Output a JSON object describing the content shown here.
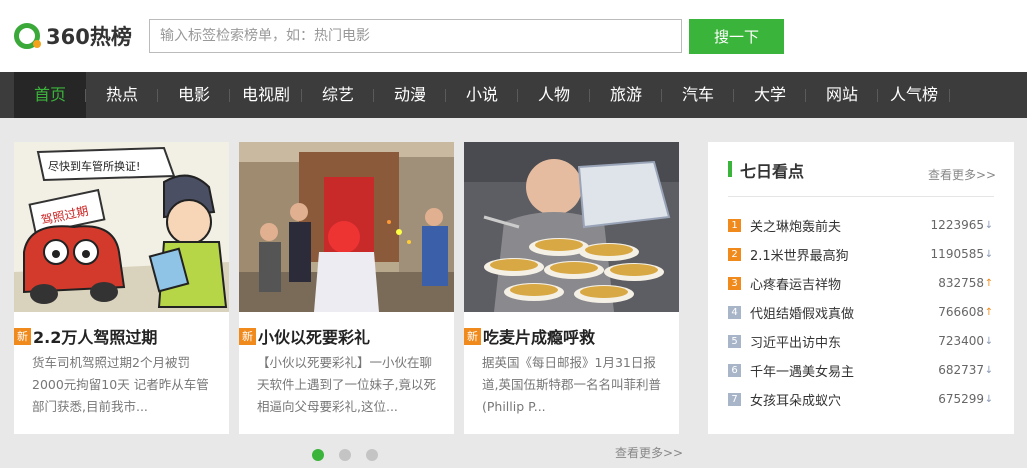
{
  "brand": {
    "logo_text": "360热榜"
  },
  "search": {
    "placeholder": "输入标签检索榜单，如：热门电影",
    "button_label": "搜一下"
  },
  "nav": {
    "items": [
      "首页",
      "热点",
      "电影",
      "电视剧",
      "综艺",
      "动漫",
      "小说",
      "人物",
      "旅游",
      "汽车",
      "大学",
      "网站",
      "人气榜"
    ],
    "active_index": 0
  },
  "cards": [
    {
      "tag": "新",
      "title": "2.2万人驾照过期",
      "desc": "货车司机驾照过期2个月被罚2000元拘留10天 记者昨从车管部门获悉,目前我市...",
      "image_text": [
        "尽快到车管所换证!",
        "驾照过期"
      ]
    },
    {
      "tag": "新",
      "title": "小伙以死要彩礼",
      "desc": "【小伙以死要彩礼】一小伙在聊天软件上遇到了一位妹子,竟以死相逼向父母要彩礼,这位..."
    },
    {
      "tag": "新",
      "title": "吃麦片成瘾呼救",
      "desc": "据英国《每日邮报》1月31日报道,英国伍斯特郡一名名叫菲利普(Phillip P..."
    }
  ],
  "carousel": {
    "more_label": "查看更多>>",
    "pages": 3,
    "active_page": 1
  },
  "seven_day": {
    "title": "七日看点",
    "more_label": "查看更多>>",
    "items": [
      {
        "rank": "1",
        "name": "关之琳炮轰前夫",
        "value": "1223965",
        "trend": "down",
        "trend_icon": "↓"
      },
      {
        "rank": "2",
        "name": "2.1米世界最高狗",
        "value": "1190585",
        "trend": "down",
        "trend_icon": "↓"
      },
      {
        "rank": "3",
        "name": "心疼春运吉祥物",
        "value": "832758",
        "trend": "up",
        "trend_icon": "↑"
      },
      {
        "rank": "4",
        "name": "代姐结婚假戏真做",
        "value": "766608",
        "trend": "up",
        "trend_icon": "↑"
      },
      {
        "rank": "5",
        "name": "习近平出访中东",
        "value": "723400",
        "trend": "down",
        "trend_icon": "↓"
      },
      {
        "rank": "6",
        "name": "千年一遇美女易主",
        "value": "682737",
        "trend": "down",
        "trend_icon": "↓"
      },
      {
        "rank": "7",
        "name": "女孩耳朵成蚁穴",
        "value": "675299",
        "trend": "down",
        "trend_icon": "↓"
      }
    ]
  },
  "colors": {
    "accent": "#3bb43b",
    "nav_bg": "#3c3c3c",
    "hot": "#f08a1c",
    "cold": "#a8b5c8"
  }
}
